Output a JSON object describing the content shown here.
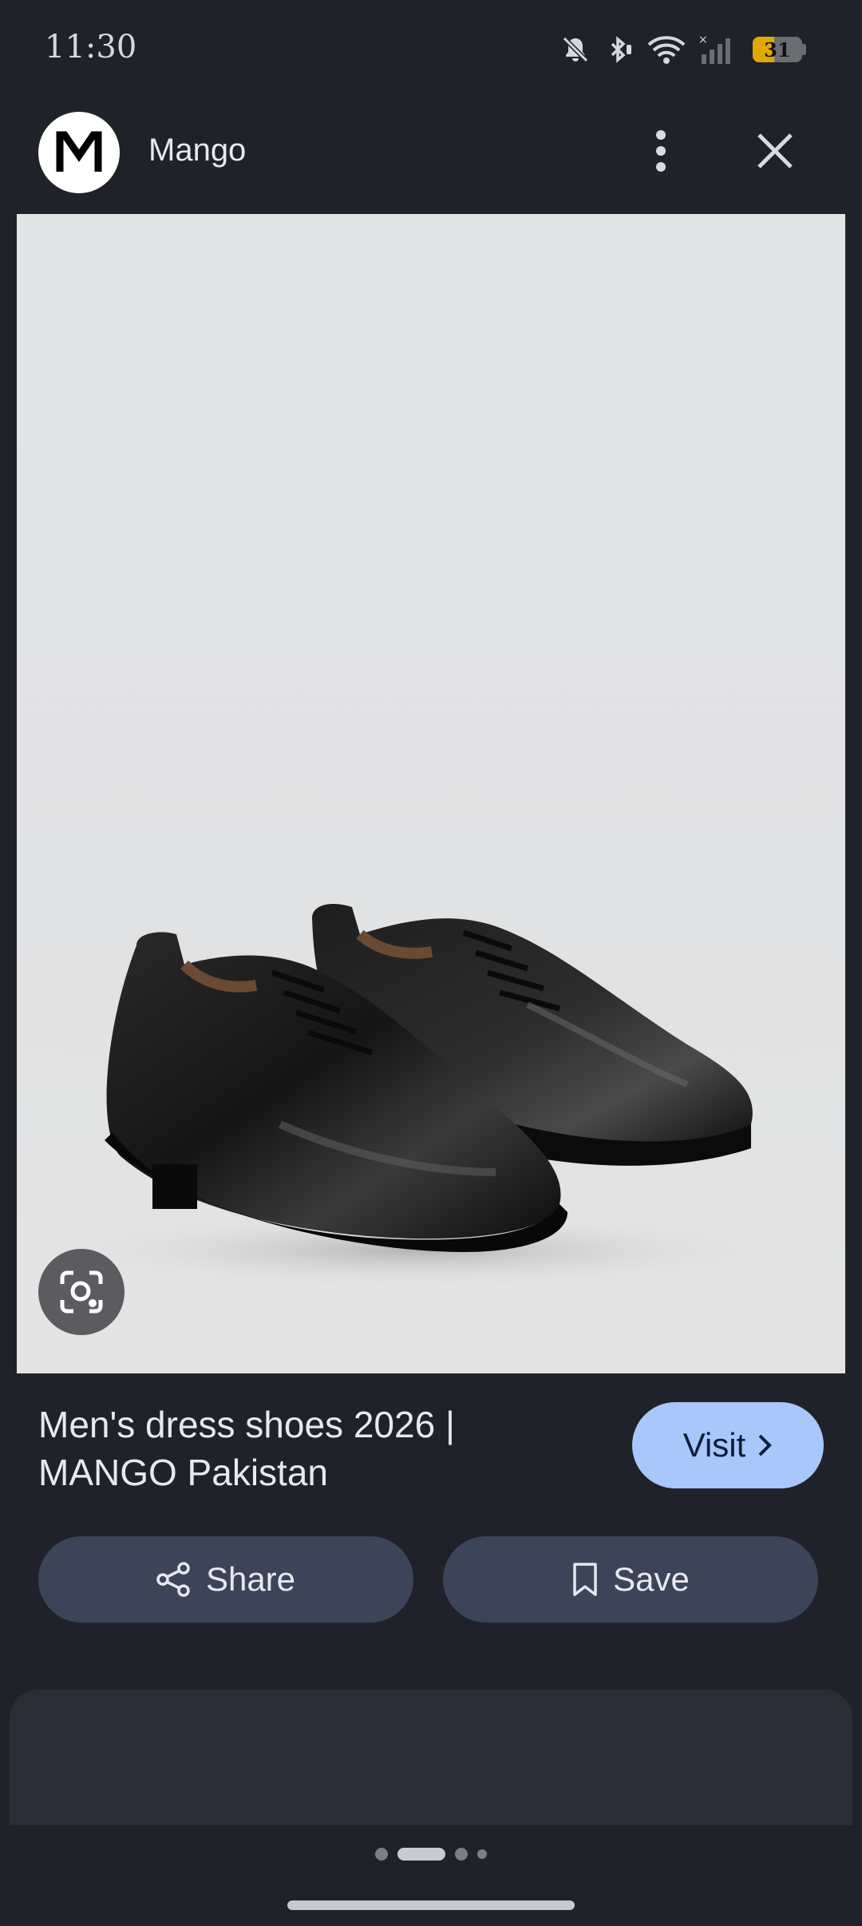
{
  "status_bar": {
    "time": "11:30",
    "battery_level": "31",
    "icons": [
      "notifications-off-icon",
      "bluetooth-icon",
      "wifi-icon",
      "cellular-signal-icon",
      "battery-icon"
    ]
  },
  "header": {
    "avatar_letter": "M",
    "site_name": "Mango",
    "menu_icon": "more-vert-icon",
    "close_icon": "close-icon"
  },
  "image": {
    "subject": "pair of black leather derby dress shoes",
    "lens_icon": "google-lens-icon"
  },
  "result": {
    "title": "Men's dress shoes 2026 | MANGO Pakistan",
    "visit_label": "Visit"
  },
  "actions": {
    "share_label": "Share",
    "save_label": "Save"
  },
  "colors": {
    "background": "#202229",
    "visit_button": "#a8c7fa",
    "action_button": "#3b4557",
    "image_background": "#e2e3e4"
  },
  "pager": {
    "total": 4,
    "active_index": 1
  }
}
